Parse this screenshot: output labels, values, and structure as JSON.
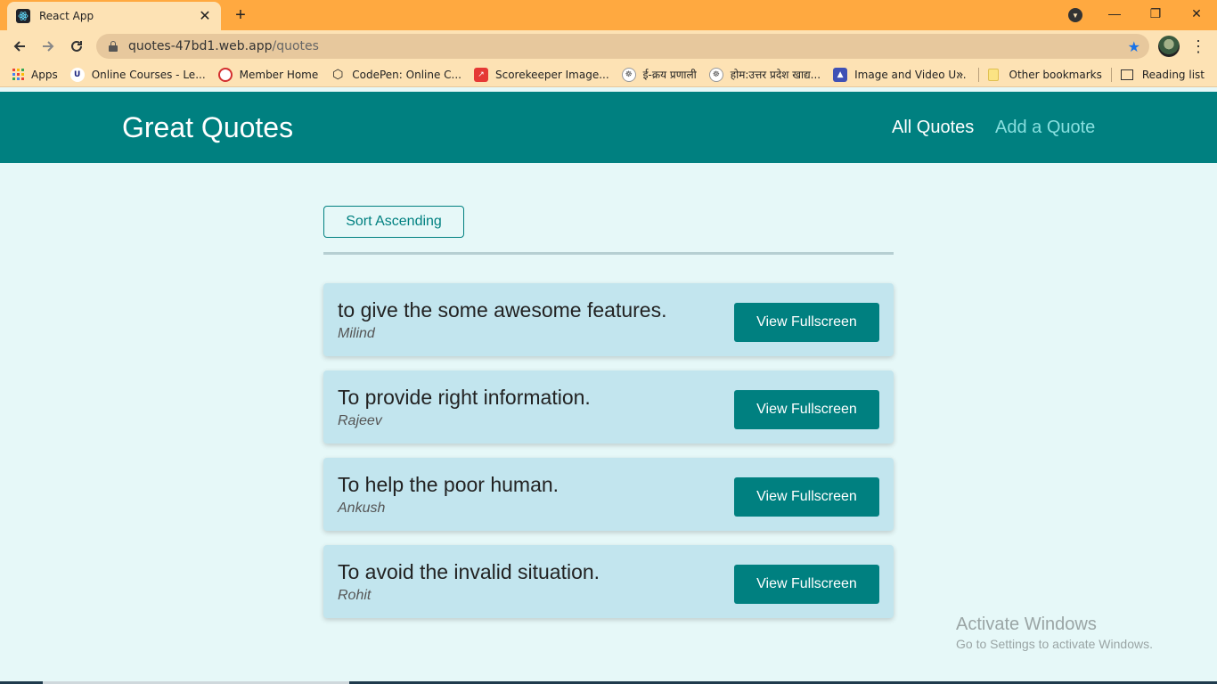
{
  "browser": {
    "tab": {
      "title": "React App",
      "favicon": "react-icon"
    },
    "new_tab": "+",
    "window_controls": {
      "minimize": "—",
      "restore": "❐",
      "close": "✕"
    },
    "address": {
      "domain": "quotes-47bd1.web.app",
      "path": "/quotes"
    },
    "bookmarks": [
      {
        "label": "Apps",
        "icon": "apps-grid-icon"
      },
      {
        "label": "Online Courses - Le...",
        "icon": "courses-icon",
        "color": "#ffffff"
      },
      {
        "label": "Member Home",
        "icon": "member-icon",
        "color": "#d32f2f"
      },
      {
        "label": "CodePen: Online C...",
        "icon": "codepen-icon",
        "color": "#222222"
      },
      {
        "label": "Scorekeeper Image...",
        "icon": "scorekeeper-icon",
        "color": "#e53935"
      },
      {
        "label": "ई-क्रय प्रणाली",
        "icon": "emblem-icon",
        "color": "#666666"
      },
      {
        "label": "होम:उत्तर प्रदेश खाद्य...",
        "icon": "emblem-icon",
        "color": "#666666"
      },
      {
        "label": "Image and Video U...",
        "icon": "image-video-icon",
        "color": "#3f51b5"
      }
    ],
    "more_bookmarks": "»",
    "other_bookmarks": "Other bookmarks",
    "reading_list": "Reading list"
  },
  "app": {
    "brand": "Great Quotes",
    "nav": {
      "all_quotes": "All Quotes",
      "add_quote": "Add a Quote"
    },
    "sort_button": "Sort Ascending",
    "quotes": [
      {
        "text": "to give the some awesome features.",
        "author": "Milind",
        "button": "View Fullscreen"
      },
      {
        "text": "To provide right information.",
        "author": "Rajeev",
        "button": "View Fullscreen"
      },
      {
        "text": "To help the poor human.",
        "author": "Ankush",
        "button": "View Fullscreen"
      },
      {
        "text": "To avoid the invalid situation.",
        "author": "Rohit",
        "button": "View Fullscreen"
      }
    ],
    "colors": {
      "primary": "#008080",
      "nav_active": "#ffffff",
      "nav_inactive": "#88dfdf",
      "card_bg": "#c2e5ee",
      "page_bg": "#e6f8f8"
    }
  },
  "watermark": {
    "title": "Activate Windows",
    "subtitle": "Go to Settings to activate Windows."
  }
}
